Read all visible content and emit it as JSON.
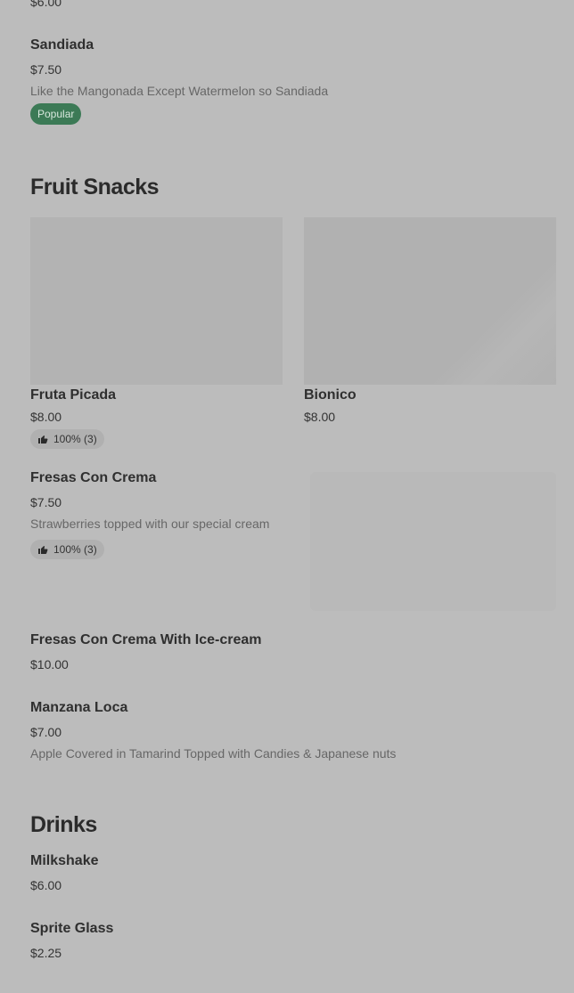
{
  "top_partial": {
    "price": "$6.00"
  },
  "sandiada": {
    "name": "Sandiada",
    "price": "$7.50",
    "description": "Like the Mangonada Except Watermelon so Sandiada",
    "badge": "Popular"
  },
  "fruit_snacks": {
    "title": "Fruit Snacks",
    "items": [
      {
        "name": "Fruta Picada",
        "price": "$8.00",
        "rating": "100% (3)"
      },
      {
        "name": "Bionico",
        "price": "$8.00"
      }
    ],
    "fresas": {
      "name": "Fresas Con Crema",
      "price": "$7.50",
      "description": "Strawberries topped with our special cream",
      "rating": "100% (3)"
    },
    "fresas_ice": {
      "name": "Fresas Con Crema With Ice-cream",
      "price": "$10.00"
    },
    "manzana": {
      "name": "Manzana Loca",
      "price": "$7.00",
      "description": "Apple Covered in Tamarind Topped with Candies & Japanese nuts"
    }
  },
  "drinks": {
    "title": "Drinks",
    "items": [
      {
        "name": "Milkshake",
        "price": "$6.00"
      },
      {
        "name": "Sprite Glass",
        "price": "$2.25"
      }
    ]
  },
  "colors": {
    "background": "#bcbcbc",
    "badge_popular": "#3c7a56",
    "image_placeholder": "#b3b3b3"
  },
  "icons": {
    "rating": "thumbs-up-icon"
  }
}
